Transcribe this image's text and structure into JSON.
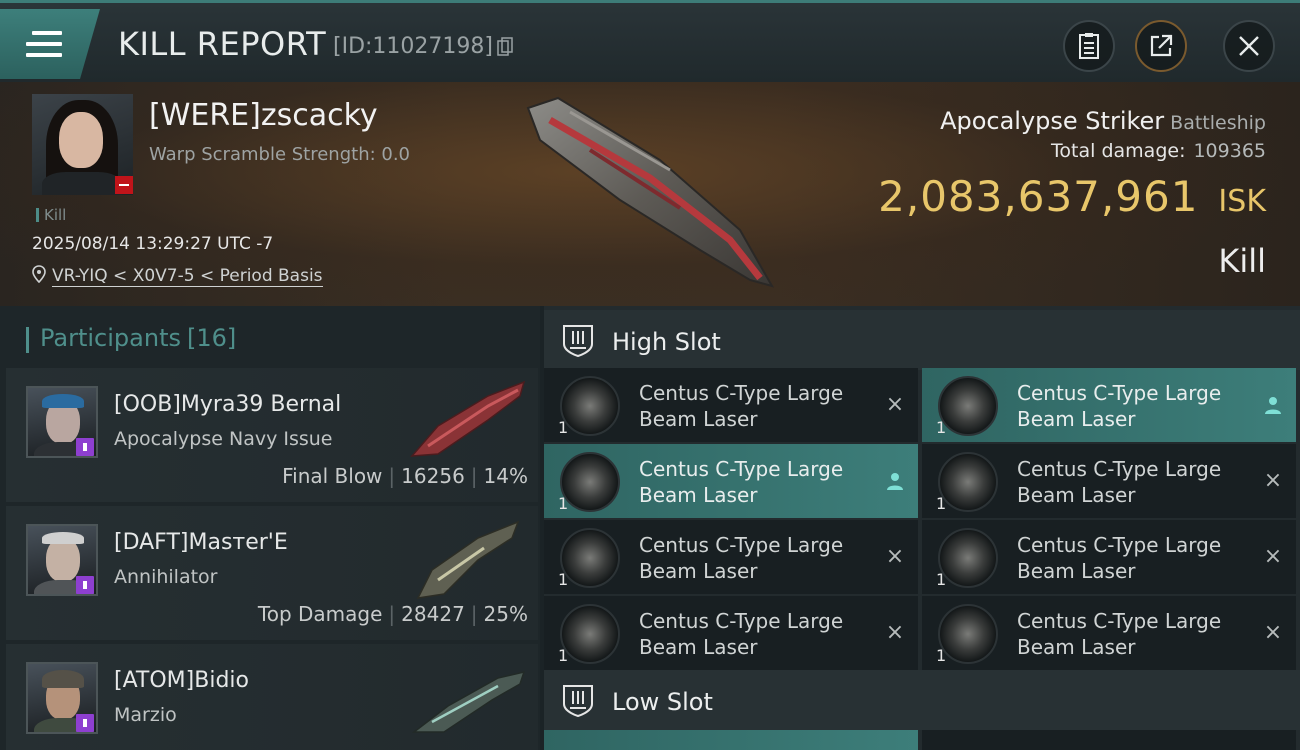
{
  "header": {
    "title": "KILL REPORT",
    "report_id": "[ID:11027198]"
  },
  "victim": {
    "name": "[WERE]zscacky",
    "warp_scramble": "Warp Scramble Strength: 0.0",
    "kill_tag": "Kill",
    "date": "2025/08/14 13:29:27 UTC -7",
    "location": "VR-YIQ < X0V7-5 < Period Basis",
    "ship_name": "Apocalypse Striker",
    "ship_class": "Battleship",
    "total_damage_label": "Total damage:",
    "total_damage": "109365",
    "isk_value": "2,083,637,961",
    "isk_unit": "ISK",
    "result": "Kill"
  },
  "participants": {
    "label": "Participants",
    "count": "[16]",
    "items": [
      {
        "name": "[OOB]Myra39 Bernal",
        "ship": "Apocalypse Navy Issue",
        "role": "Final Blow",
        "damage": "16256",
        "percent": "14%"
      },
      {
        "name": "[DAFT]Masтer'E",
        "ship": "Annihilator",
        "role": "Top Damage",
        "damage": "28427",
        "percent": "25%"
      },
      {
        "name": "[ATOM]Bidio",
        "ship": "Marzio",
        "role": "",
        "damage": "",
        "percent": ""
      }
    ]
  },
  "slots": {
    "high": {
      "title": "High Slot",
      "modules": [
        {
          "name": "Centus C-Type Large Beam Laser",
          "qty": "1",
          "mark": "×",
          "active": false
        },
        {
          "name": "Centus C-Type Large Beam Laser",
          "qty": "1",
          "mark": "person",
          "active": true
        },
        {
          "name": "Centus C-Type Large Beam Laser",
          "qty": "1",
          "mark": "person",
          "active": true
        },
        {
          "name": "Centus C-Type Large Beam Laser",
          "qty": "1",
          "mark": "×",
          "active": false
        },
        {
          "name": "Centus C-Type Large Beam Laser",
          "qty": "1",
          "mark": "×",
          "active": false
        },
        {
          "name": "Centus C-Type Large Beam Laser",
          "qty": "1",
          "mark": "×",
          "active": false
        },
        {
          "name": "Centus C-Type Large Beam Laser",
          "qty": "1",
          "mark": "×",
          "active": false
        },
        {
          "name": "Centus C-Type Large Beam Laser",
          "qty": "1",
          "mark": "×",
          "active": false
        }
      ]
    },
    "low": {
      "title": "Low Slot"
    }
  },
  "colors": {
    "accent": "#3d7e7a",
    "isk": "#e8c66a",
    "badge_red": "#c0141a",
    "badge_purple": "#8e3fd0"
  }
}
